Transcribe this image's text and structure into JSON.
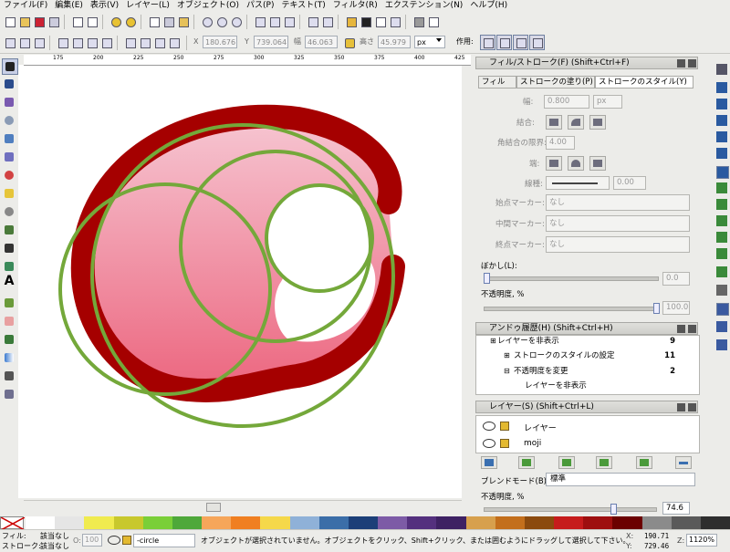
{
  "menu": [
    "ファイル(F)",
    "編集(E)",
    "表示(V)",
    "レイヤー(L)",
    "オブジェクト(O)",
    "パス(P)",
    "テキスト(T)",
    "フィルタ(R)",
    "エクステンション(N)",
    "ヘルプ(H)"
  ],
  "toolbar": {
    "x_label": "X",
    "x_value": "180.676",
    "y_label": "Y",
    "y_value": "739.064",
    "w_label": "幅",
    "w_value": "46.063",
    "h_label": "高さ",
    "h_value": "45.979",
    "unit": "px",
    "affect_label": "作用:"
  },
  "ruler": {
    "ticks": [
      "175",
      "200",
      "225",
      "250",
      "275",
      "300",
      "325",
      "350",
      "375",
      "400",
      "425"
    ]
  },
  "fill_stroke": {
    "title": "フィル/ストローク(F) (Shift+Ctrl+F)",
    "tabs": [
      "フィル",
      "ストロークの塗り(P)",
      "ストロークのスタイル(Y)"
    ],
    "width_label": "幅:",
    "width_value": "0.800",
    "width_unit": "px",
    "join_label": "結合:",
    "miter_label": "角結合の限界:",
    "miter_value": "4.00",
    "cap_label": "端:",
    "dash_label": "線種:",
    "dash_value": "0.00",
    "start_marker_label": "始点マーカー:",
    "start_marker_value": "なし",
    "mid_marker_label": "中間マーカー:",
    "mid_marker_value": "なし",
    "end_marker_label": "終点マーカー:",
    "end_marker_value": "なし",
    "blur_label": "ぼかし(L):",
    "blur_value": "0.0",
    "blur_level": 0.0,
    "opacity_label": "不透明度, %",
    "opacity_value": "100.0",
    "opacity_level": 1.0
  },
  "undo_history": {
    "title": "アンドゥ履歴(H) (Shift+Ctrl+H)",
    "items": [
      {
        "label": "レイヤーを非表示",
        "count": "9"
      },
      {
        "label": "ストロークのスタイルの設定",
        "count": "11"
      },
      {
        "label": "不透明度を変更",
        "count": "2"
      },
      {
        "label": "レイヤーを非表示",
        "count": ""
      }
    ]
  },
  "layers": {
    "title": "レイヤー(S) (Shift+Ctrl+L)",
    "items": [
      "レイヤー",
      "moji"
    ],
    "blend_label": "ブレンドモード(B)",
    "blend_value": "標準",
    "opacity_label": "不透明度, %",
    "opacity_value": "74.6",
    "opacity_level": 0.746
  },
  "palette_colors": [
    "#ffffff",
    "#e5e5e5",
    "#f0eb4f",
    "#c8c82d",
    "#7acf38",
    "#4ea83a",
    "#f6a65a",
    "#f07f21",
    "#f5d84a",
    "#8fb1d8",
    "#3b6ea8",
    "#1c3f78",
    "#7d5ba6",
    "#54307e",
    "#3e2163",
    "#d7a04d",
    "#c36f1c",
    "#8b4a0e",
    "#c61c1c",
    "#9e0f0f",
    "#6b0000",
    "#8b8b8b",
    "#5a5a5a",
    "#2e2e2e"
  ],
  "status": {
    "fill_label": "フィル:",
    "fill_value": "該当なし",
    "stroke_label": "ストローク:",
    "stroke_value": "該当なし",
    "opacity_label": "O:",
    "opacity_value": "100",
    "layer_value": "-circle",
    "message": "オブジェクトが選択されていません。オブジェクトをクリック、Shift+クリック、または囲むようにドラッグして選択して下さい。",
    "x_label": "X:",
    "x_value": "190.71",
    "y_label": "Y:",
    "y_value": "729.46",
    "zoom_label": "Z:",
    "zoom_value": "1120%"
  },
  "colors": {
    "dark_red": "#a50000",
    "green": "#74a83a",
    "pink_top": "#f4b6c4",
    "pink_bottom": "#ed6b84"
  }
}
